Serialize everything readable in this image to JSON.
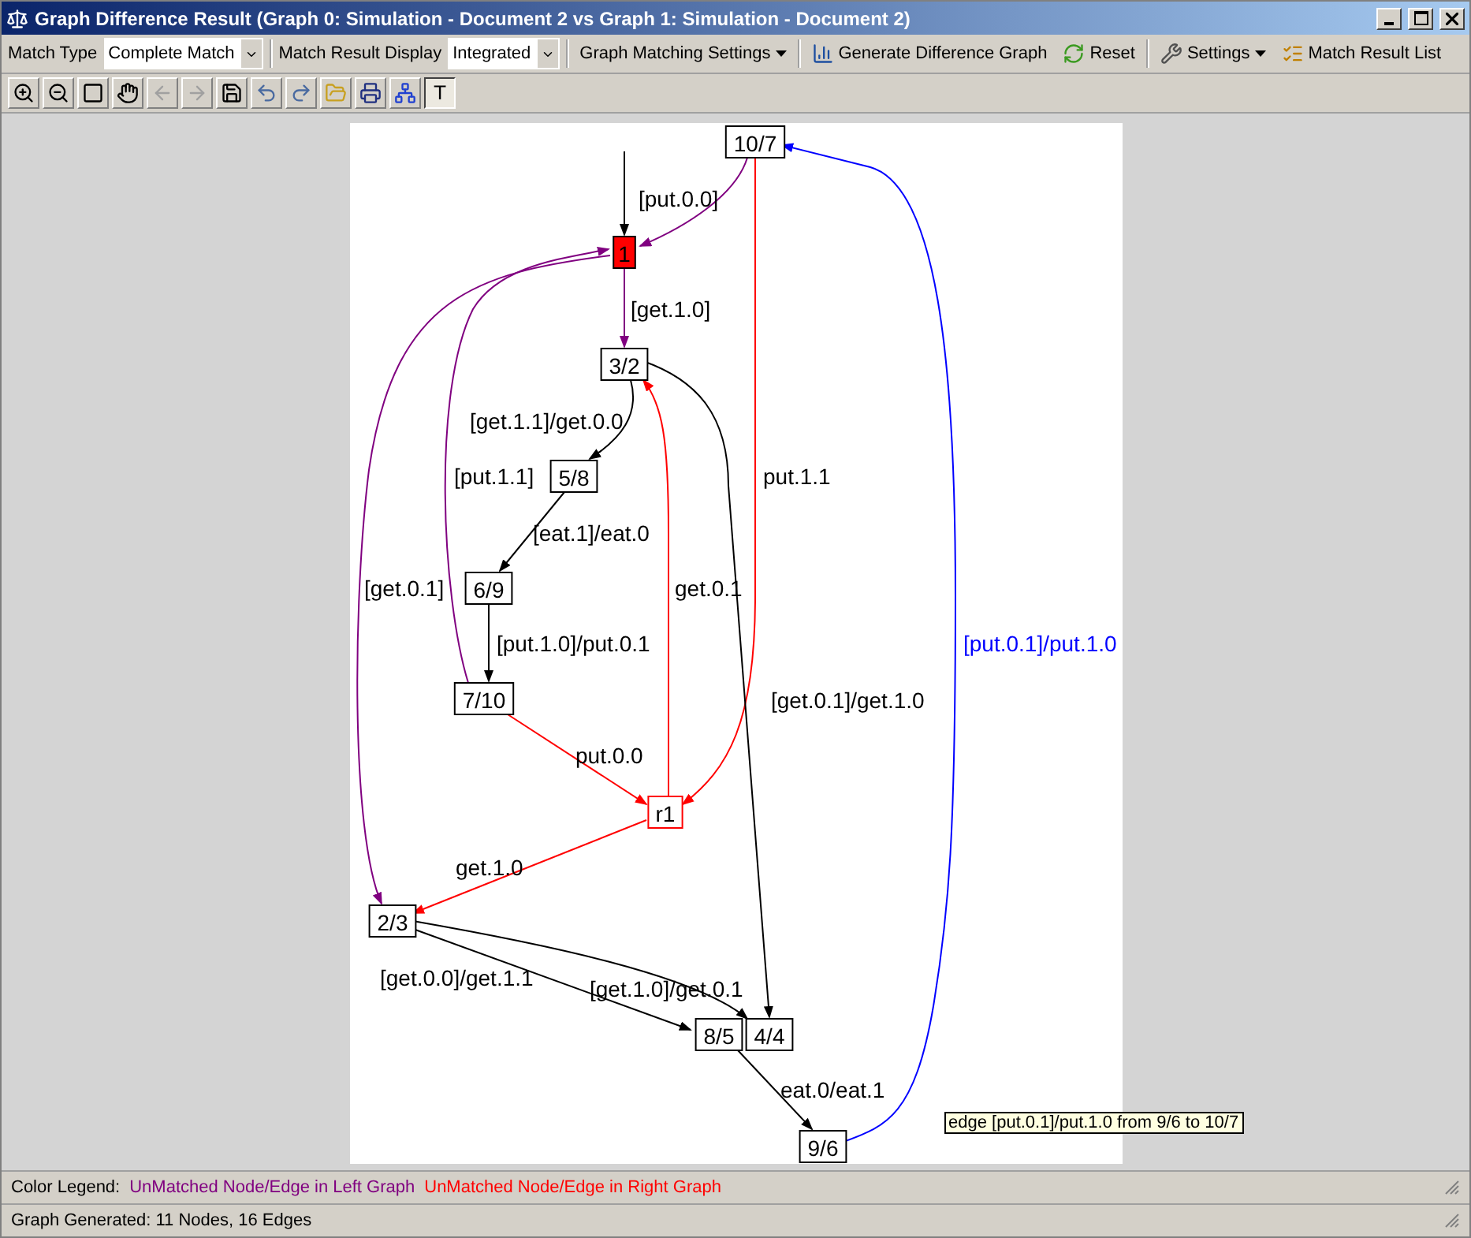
{
  "window": {
    "title": "Graph Difference Result (Graph 0: Simulation - Document 2 vs Graph 1: Simulation - Document 2)"
  },
  "toolbar": {
    "match_type": {
      "label": "Match Type",
      "value": "Complete Match"
    },
    "match_display": {
      "label": "Match Result Display",
      "value": "Integrated"
    },
    "buttons": [
      {
        "kind": "matching_settings",
        "label": "Graph Matching Settings"
      },
      {
        "kind": "generate",
        "label": "Generate Difference Graph"
      },
      {
        "kind": "reset",
        "label": "Reset"
      },
      {
        "kind": "settings",
        "label": "Settings"
      },
      {
        "kind": "result_list",
        "label": "Match Result List"
      }
    ]
  },
  "tools": [
    {
      "kind": "zoom_in",
      "disabled": false
    },
    {
      "kind": "zoom_out",
      "disabled": false
    },
    {
      "kind": "select_rect",
      "disabled": false
    },
    {
      "kind": "pan",
      "disabled": false
    },
    {
      "kind": "back",
      "disabled": true
    },
    {
      "kind": "forward",
      "disabled": true
    },
    {
      "kind": "save",
      "disabled": false
    },
    {
      "kind": "undo",
      "disabled": false
    },
    {
      "kind": "redo",
      "disabled": false
    },
    {
      "kind": "open",
      "disabled": false
    },
    {
      "kind": "print",
      "disabled": false
    },
    {
      "kind": "layout",
      "disabled": false
    }
  ],
  "text_tool": {
    "label": "T",
    "pressed": true
  },
  "graph": {
    "nodes": [
      {
        "label": "10/7",
        "kind": "matched"
      },
      {
        "label": "1",
        "kind": "initial"
      },
      {
        "label": "3/2",
        "kind": "matched"
      },
      {
        "label": "5/8",
        "kind": "matched"
      },
      {
        "label": "6/9",
        "kind": "matched"
      },
      {
        "label": "7/10",
        "kind": "matched"
      },
      {
        "label": "r1",
        "kind": "right"
      },
      {
        "label": "2/3",
        "kind": "matched"
      },
      {
        "label": "8/5",
        "kind": "matched"
      },
      {
        "label": "4/4",
        "kind": "matched"
      },
      {
        "label": "9/6",
        "kind": "matched"
      }
    ],
    "edges": [
      {
        "label": "[put.0.0]",
        "kind": "left"
      },
      {
        "label": "[get.1.0]",
        "kind": "left"
      },
      {
        "label": "[get.1.1]/get.0.0",
        "kind": "matched"
      },
      {
        "label": "[put.1.1]",
        "kind": "left"
      },
      {
        "label": "[eat.1]/eat.0",
        "kind": "matched"
      },
      {
        "label": "[get.0.1]",
        "kind": "left"
      },
      {
        "label": "[put.1.0]/put.0.1",
        "kind": "matched"
      },
      {
        "label": "get.0.1",
        "kind": "right"
      },
      {
        "label": "put.1.1",
        "kind": "right"
      },
      {
        "label": "[get.0.1]/get.1.0",
        "kind": "matched"
      },
      {
        "label": "put.0.0",
        "kind": "right"
      },
      {
        "label": "get.1.0",
        "kind": "right"
      },
      {
        "label": "[get.0.0]/get.1.1",
        "kind": "matched"
      },
      {
        "label": "[get.1.0]/get.0.1",
        "kind": "matched"
      },
      {
        "label": "eat.0/eat.1",
        "kind": "matched"
      },
      {
        "label": "[put.0.1]/put.1.0",
        "kind": "selected"
      }
    ],
    "tooltip": "edge [put.0.1]/put.1.0 from 9/6 to 10/7"
  },
  "legend": {
    "label": "Color Legend:",
    "items": [
      {
        "label": "UnMatched Node/Edge in Left Graph",
        "color": "#800080"
      },
      {
        "label": "UnMatched Node/Edge in Right Graph",
        "color": "#ff0000"
      }
    ]
  },
  "status_bar": "Graph Generated: 11 Nodes, 16 Edges"
}
